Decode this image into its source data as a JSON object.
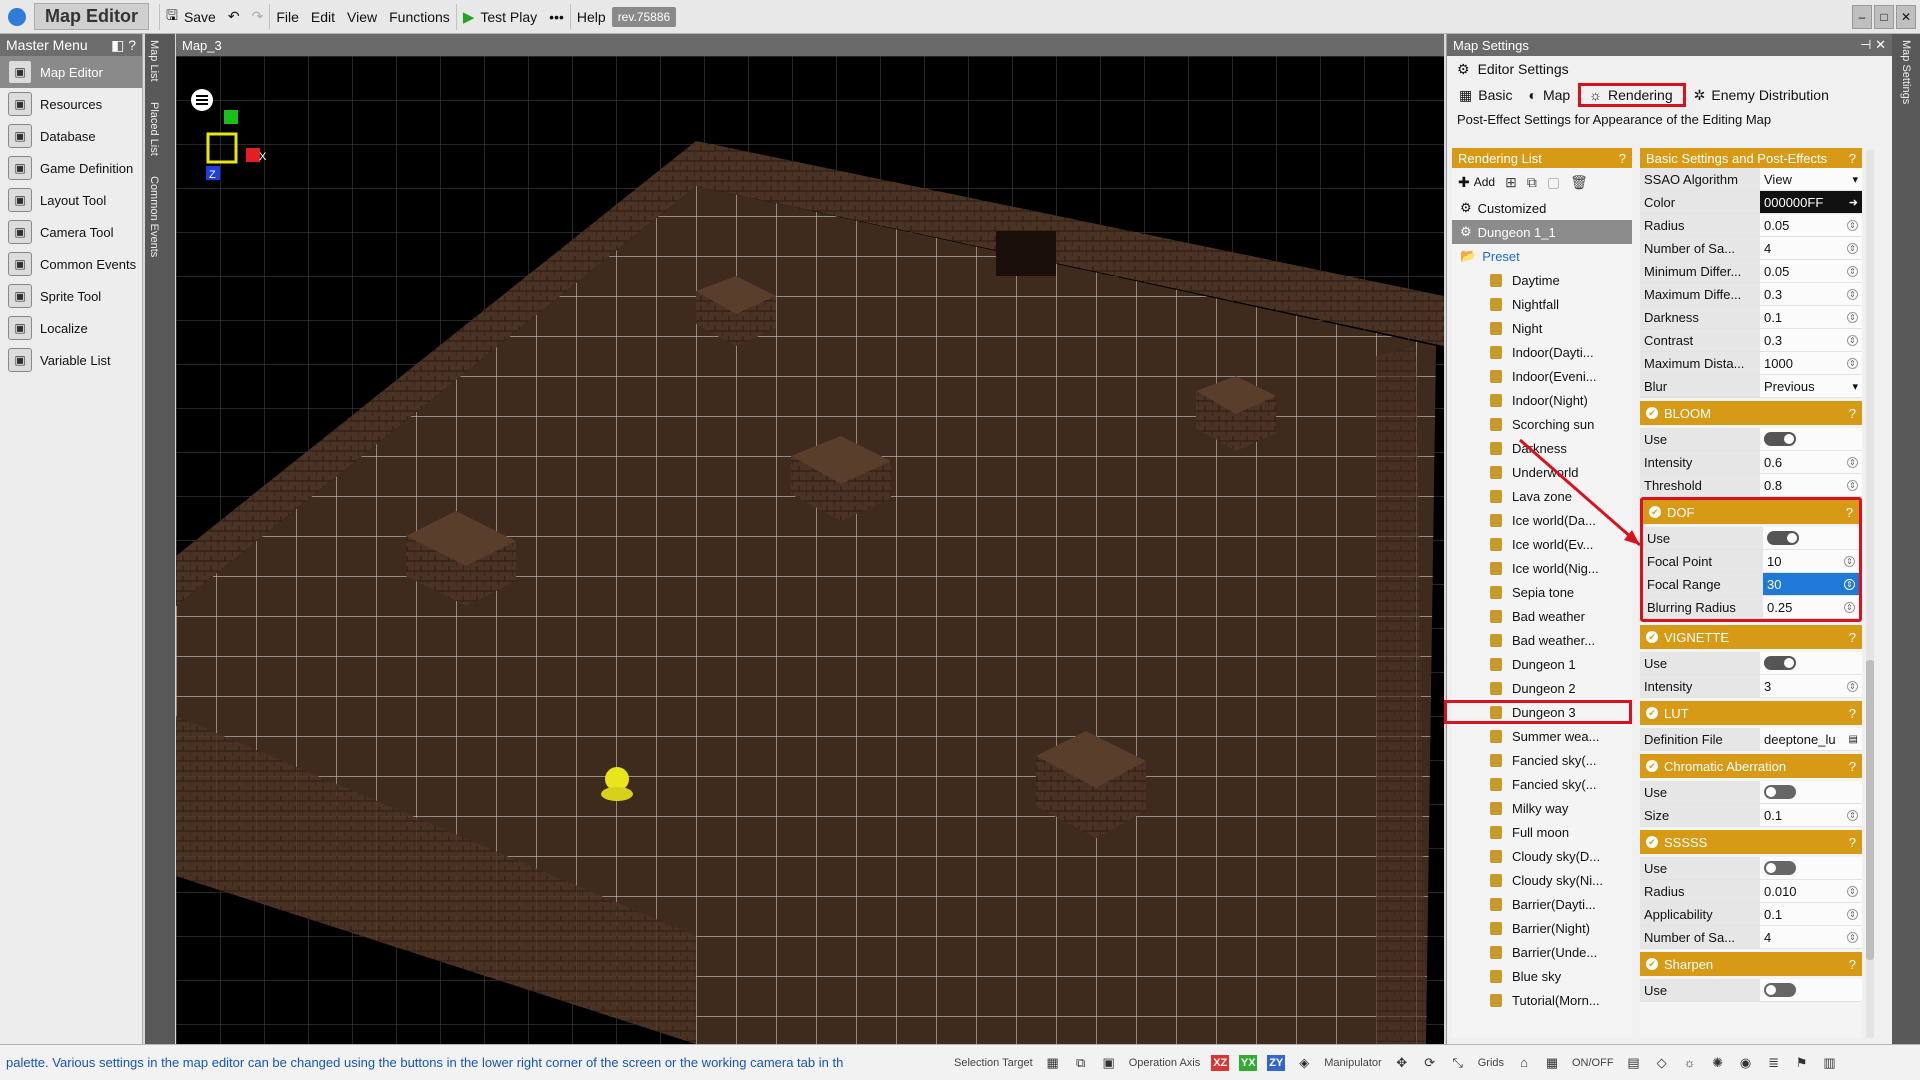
{
  "app": {
    "title": "Map Editor",
    "revision": "rev.75886"
  },
  "toolbar": {
    "save": "Save",
    "file": "File",
    "edit": "Edit",
    "view": "View",
    "functions": "Functions",
    "test_play": "Test Play",
    "more": "•••",
    "help": "Help"
  },
  "master_menu": {
    "title": "Master Menu",
    "items": [
      {
        "label": "Map Editor",
        "icon": "map-editor-icon"
      },
      {
        "label": "Resources",
        "icon": "resources-icon"
      },
      {
        "label": "Database",
        "icon": "database-icon"
      },
      {
        "label": "Game Definition",
        "icon": "game-definition-icon"
      },
      {
        "label": "Layout Tool",
        "icon": "layout-tool-icon"
      },
      {
        "label": "Camera Tool",
        "icon": "camera-tool-icon"
      },
      {
        "label": "Common Events",
        "icon": "common-events-icon"
      },
      {
        "label": "Sprite Tool",
        "icon": "sprite-tool-icon"
      },
      {
        "label": "Localize",
        "icon": "localize-icon"
      },
      {
        "label": "Variable List",
        "icon": "variable-list-icon"
      }
    ]
  },
  "side_tabs": {
    "map_list": "Map List",
    "placed_list": "Placed List",
    "common_events": "Common Events"
  },
  "viewport": {
    "title": "Map_3",
    "gizmo": {
      "x": "X",
      "z": "Z"
    }
  },
  "settings": {
    "title": "Map Settings",
    "editor_settings": "Editor Settings",
    "tabs": {
      "basic": "Basic",
      "map": "Map",
      "rendering": "Rendering",
      "enemy": "Enemy Distribution"
    },
    "description": "Post-Effect Settings for Appearance of the Editing Map",
    "rendering_list": {
      "title": "Rendering List",
      "add": "Add",
      "customized": "Customized",
      "selected": "Dungeon 1_1",
      "preset": "Preset",
      "presets": [
        "Daytime",
        "Nightfall",
        "Night",
        "Indoor(Dayti...",
        "Indoor(Eveni...",
        "Indoor(Night)",
        "Scorching sun",
        "Darkness",
        "Underworld",
        "Lava zone",
        "Ice world(Da...",
        "Ice world(Ev...",
        "Ice world(Nig...",
        "Sepia tone",
        "Bad weather",
        "Bad weather...",
        "Dungeon 1",
        "Dungeon 2",
        "Dungeon 3",
        "Summer wea...",
        "Fancied sky(...",
        "Fancied sky(...",
        "Milky way",
        "Full moon",
        "Cloudy sky(D...",
        "Cloudy sky(Ni...",
        "Barrier(Dayti...",
        "Barrier(Night)",
        "Barrier(Unde...",
        "Blue sky",
        "Tutorial(Morn..."
      ]
    },
    "basic_settings": {
      "title": "Basic Settings and Post-Effects",
      "rows": [
        {
          "name": "SSAO Algorithm",
          "value": "View"
        },
        {
          "name": "Color",
          "value": "000000FF"
        },
        {
          "name": "Radius",
          "value": "0.05"
        },
        {
          "name": "Number of Sa...",
          "value": "4"
        },
        {
          "name": "Minimum Differ...",
          "value": "0.05"
        },
        {
          "name": "Maximum Diffe...",
          "value": "0.3"
        },
        {
          "name": "Darkness",
          "value": "0.1"
        },
        {
          "name": "Contrast",
          "value": "0.3"
        },
        {
          "name": "Maximum Dista...",
          "value": "1000"
        },
        {
          "name": "Blur",
          "value": "Previous"
        }
      ]
    },
    "bloom": {
      "title": "BLOOM",
      "use": "Use",
      "intensity": "Intensity",
      "intensity_val": "0.6",
      "threshold": "Threshold",
      "threshold_val": "0.8"
    },
    "dof": {
      "title": "DOF",
      "use": "Use",
      "focal_point": "Focal Point",
      "focal_point_val": "10",
      "focal_range": "Focal Range",
      "focal_range_val": "30",
      "blur_radius": "Blurring Radius",
      "blur_radius_val": "0.25"
    },
    "vignette": {
      "title": "VIGNETTE",
      "use": "Use",
      "intensity": "Intensity",
      "intensity_val": "3"
    },
    "lut": {
      "title": "LUT",
      "def_file": "Definition File",
      "def_file_val": "deeptone_lu"
    },
    "chromatic": {
      "title": "Chromatic Aberration",
      "use": "Use",
      "size": "Size",
      "size_val": "0.1"
    },
    "sssss": {
      "title": "SSSSS",
      "use": "Use",
      "radius": "Radius",
      "radius_val": "0.010",
      "applicability": "Applicability",
      "applicability_val": "0.1",
      "samples": "Number of Sa...",
      "samples_val": "4"
    },
    "sharpen": {
      "title": "Sharpen",
      "use": "Use"
    },
    "help": "?"
  },
  "status": {
    "message": "palette.  Various settings in the map editor can be changed using the buttons in the lower right corner of the screen or the working camera tab in th",
    "selection_target": "Selection Target",
    "operation_axis": "Operation Axis",
    "axes": [
      "XZ",
      "YX",
      "ZY"
    ],
    "manipulator": "Manipulator",
    "grids": "Grids",
    "onoff": "ON/OFF"
  },
  "right_strip": "Map Settings",
  "colors": {
    "accent_orange": "#d79a16",
    "highlight_red": "#d7121e",
    "selection_blue": "#1e7ad6"
  }
}
